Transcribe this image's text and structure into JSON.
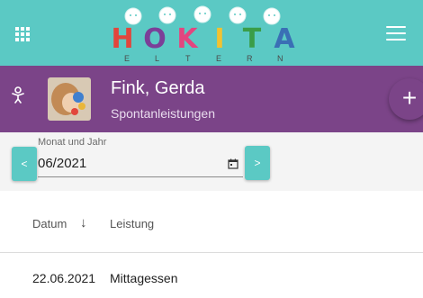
{
  "colors": {
    "topbar": "#5bc9c4",
    "profile_bar": "#7b4488",
    "accent": "#5bc9c4"
  },
  "logo": {
    "letters": [
      {
        "char": "H",
        "color": "#e2453c"
      },
      {
        "char": "O",
        "color": "#7b3f98"
      },
      {
        "char": "K",
        "color": "#e3457f"
      },
      {
        "char": "I",
        "color": "#f2c230"
      },
      {
        "char": "T",
        "color": "#3a9d48"
      },
      {
        "char": "A",
        "color": "#3a6fb5"
      }
    ],
    "subtitle_letters": [
      "E",
      "L",
      "T",
      "E",
      "R",
      "N"
    ]
  },
  "header": {
    "apps_icon": "grid-icon",
    "menu_icon": "hamburger-icon"
  },
  "profile": {
    "name": "Fink, Gerda",
    "subtitle": "Spontanleistungen",
    "add_button": "+"
  },
  "filter": {
    "label": "Monat und Jahr",
    "value": "06/2021",
    "prev_label": "<",
    "next_label": ">"
  },
  "table": {
    "columns": [
      "Datum",
      "Leistung"
    ],
    "sort_icon": "↓",
    "rows": [
      {
        "date": "22.06.2021",
        "service": "Mittagessen"
      }
    ]
  }
}
